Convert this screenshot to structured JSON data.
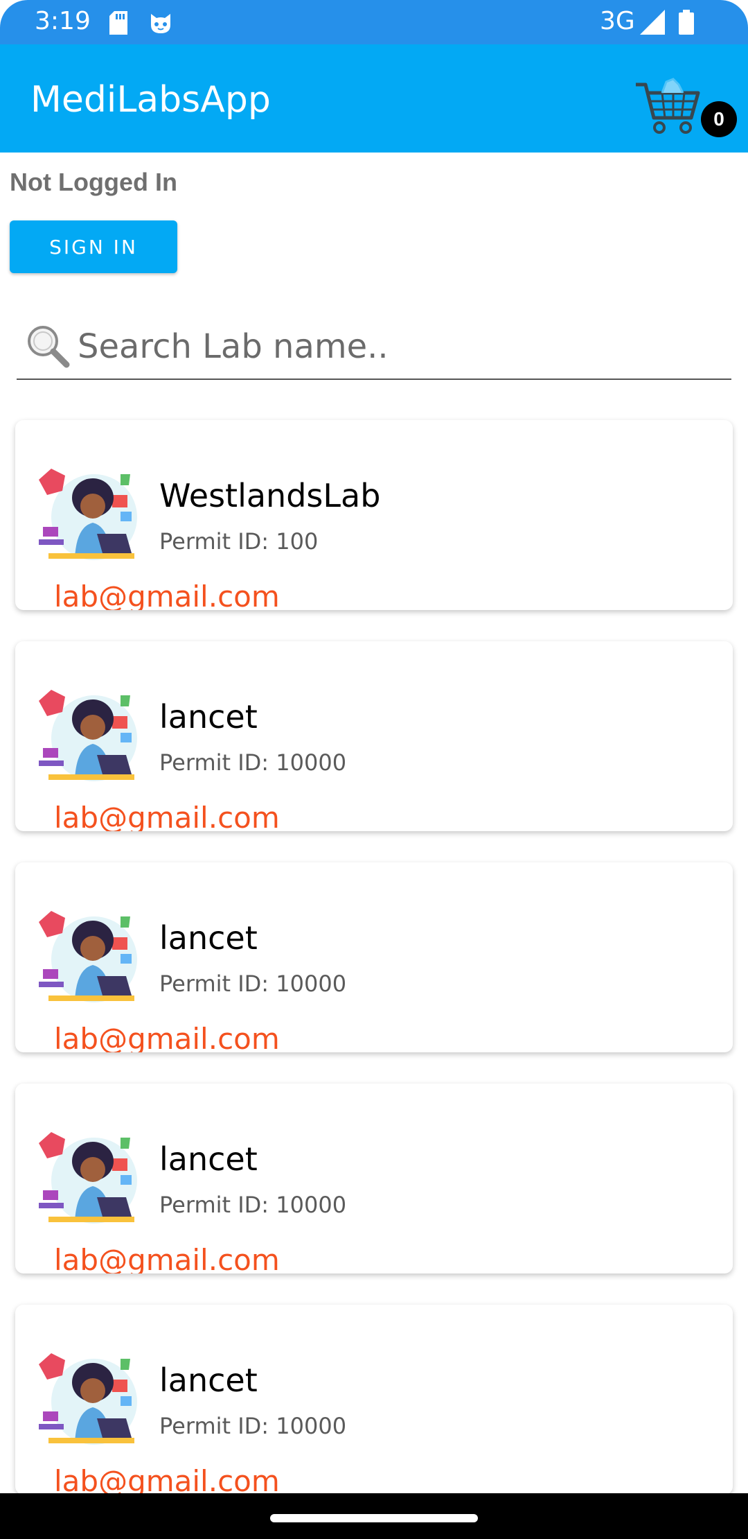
{
  "status_bar": {
    "time": "3:19",
    "network": "3G",
    "icons": [
      "sd-card-icon",
      "cat-icon",
      "signal-icon",
      "battery-icon"
    ]
  },
  "app_bar": {
    "title": "MediLabsApp",
    "cart_count": "0",
    "cart_icon": "shopping-cart-icon"
  },
  "auth": {
    "status_text": "Not Logged In",
    "sign_in_label": "SIGN IN"
  },
  "search": {
    "placeholder": "Search Lab name..",
    "value": "",
    "icon": "magnifier-icon"
  },
  "labs": [
    {
      "name": "WestlandsLab",
      "permit": "Permit ID: 100",
      "email": "lab@gmail.com"
    },
    {
      "name": "lancet",
      "permit": "Permit ID: 10000",
      "email": "lab@gmail.com"
    },
    {
      "name": "lancet",
      "permit": "Permit ID: 10000",
      "email": "lab@gmail.com"
    },
    {
      "name": "lancet",
      "permit": "Permit ID: 10000",
      "email": "lab@gmail.com"
    },
    {
      "name": "lancet",
      "permit": "Permit ID: 10000",
      "email": "lab@gmail.com"
    }
  ],
  "colors": {
    "status_bar": "#2690ea",
    "app_bar": "#03a9f4",
    "accent": "#03a9f4",
    "email": "#f4511e",
    "badge": "#000000"
  }
}
